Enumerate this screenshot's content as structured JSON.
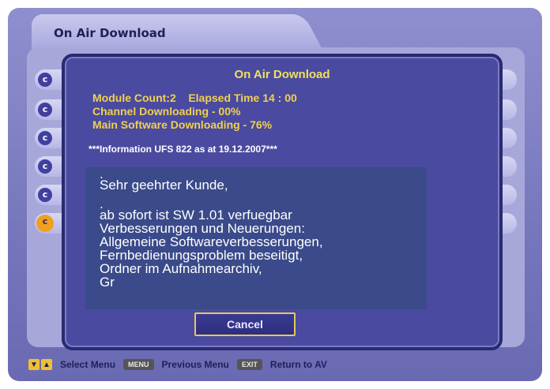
{
  "window": {
    "tab_title": "On Air Download"
  },
  "dialog": {
    "title": "On Air Download",
    "module_count": "Module Count:2",
    "elapsed_time": "Elapsed Time  14 : 00",
    "channel_downloading": "Channel Downloading - 00%",
    "main_software_downloading": "Main Software Downloading - 76%",
    "info_header": "***Information UFS 822 as at 19.12.2007***",
    "message_lines": [
      ".",
      "Sehr geehrter Kunde,",
      ".",
      "ab sofort ist SW 1.01 verfuegbar",
      "Verbesserungen und Neuerungen:",
      "Allgemeine Softwareverbesserungen,",
      "Fernbedienungsproblem beseitigt,",
      "Ordner im Aufnahmearchiv,",
      "Gr"
    ],
    "cancel_label": "Cancel"
  },
  "footer": {
    "select_label": "Select Menu",
    "menu_key": "MENU",
    "previous_label": "Previous Menu",
    "exit_key": "EXIT",
    "return_label": "Return to AV"
  },
  "colors": {
    "accent_yellow": "#f0d050",
    "dialog_bg": "#4a4aa0",
    "frame_bg": "#7676bc"
  }
}
